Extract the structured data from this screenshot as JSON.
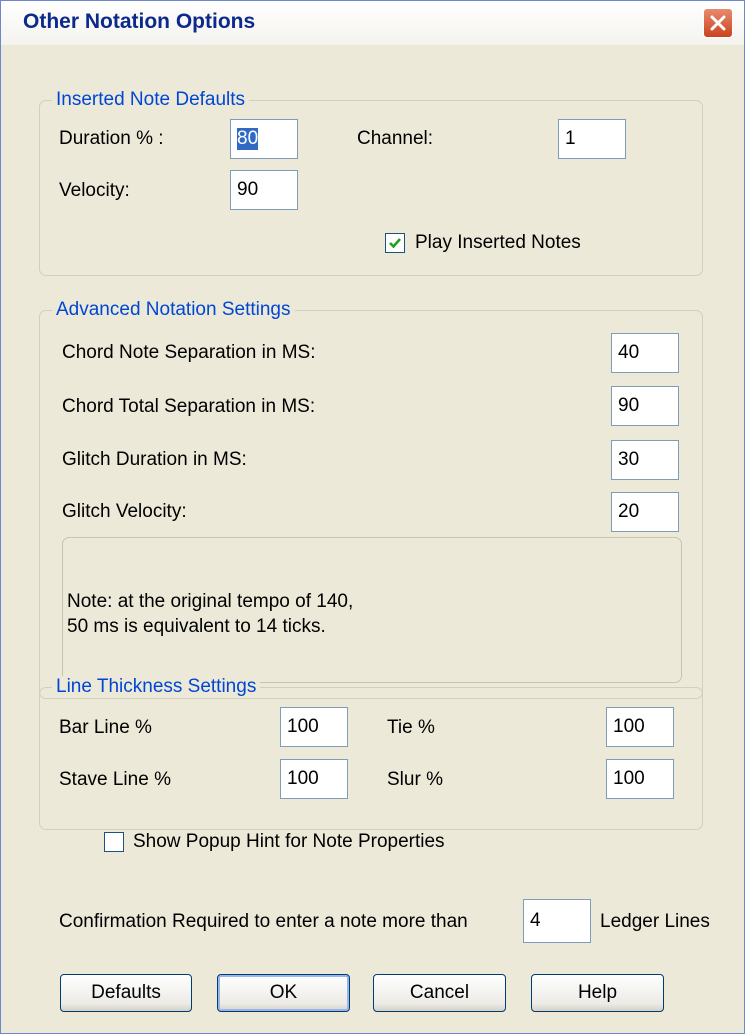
{
  "dialog": {
    "title": "Other Notation Options"
  },
  "inserted": {
    "legend": "Inserted Note Defaults",
    "duration_label": "Duration % :",
    "duration_value": "80",
    "channel_label": "Channel:",
    "channel_value": "1",
    "velocity_label": "Velocity:",
    "velocity_value": "90",
    "play_label": "Play Inserted Notes",
    "play_checked": true
  },
  "advanced": {
    "legend": "Advanced Notation Settings",
    "chord_note_label": "Chord Note Separation in MS:",
    "chord_note_value": "40",
    "chord_total_label": "Chord Total Separation in MS:",
    "chord_total_value": "90",
    "glitch_duration_label": "Glitch Duration in MS:",
    "glitch_duration_value": "30",
    "glitch_velocity_label": "Glitch Velocity:",
    "glitch_velocity_value": "20",
    "note_line1": "Note: at the original tempo of 140,",
    "note_line2": "50 ms is equivalent to 14 ticks."
  },
  "thickness": {
    "legend": "Line Thickness Settings",
    "bar_label": "Bar Line %",
    "bar_value": "100",
    "tie_label": "Tie %",
    "tie_value": "100",
    "stave_label": "Stave Line %",
    "stave_value": "100",
    "slur_label": "Slur %",
    "slur_value": "100"
  },
  "popup_hint": {
    "label": "Show Popup Hint for Note Properties",
    "checked": false
  },
  "confirmation": {
    "prefix": "Confirmation Required to enter a note more than",
    "value": "4",
    "suffix": "Ledger Lines"
  },
  "buttons": {
    "defaults": "Defaults",
    "ok": "OK",
    "cancel": "Cancel",
    "help": "Help"
  },
  "colors": {
    "legend": "#0046d5",
    "dialog_bg": "#ece9d8",
    "close_button": "#d4532c"
  }
}
